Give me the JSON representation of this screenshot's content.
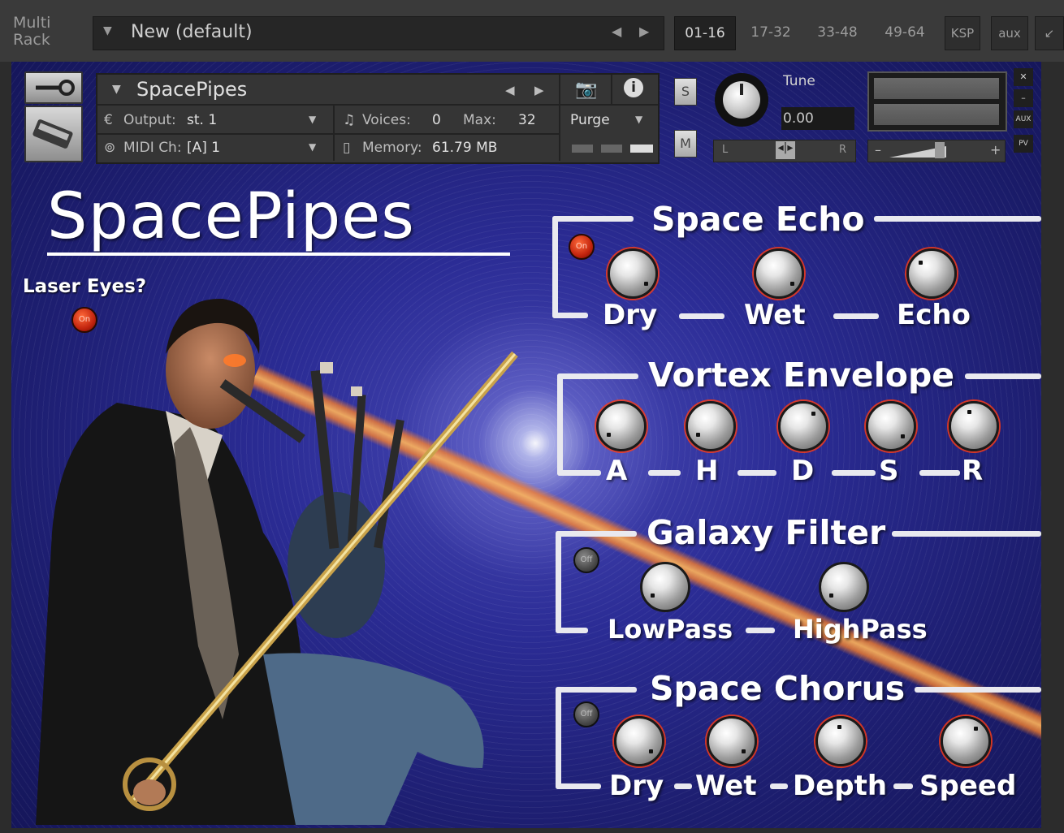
{
  "topbar": {
    "rack_label_line1": "Multi",
    "rack_label_line2": "Rack",
    "preset_name": "New (default)",
    "pages": [
      "01-16",
      "17-32",
      "33-48",
      "49-64"
    ],
    "active_page": "01-16",
    "ksp_label": "KSP",
    "aux_label": "aux"
  },
  "instrument": {
    "name": "SpacePipes",
    "output_label": "Output:",
    "output_value": "st. 1",
    "voices_label": "Voices:",
    "voices_value": "0",
    "max_label": "Max:",
    "max_value": "32",
    "purge_label": "Purge",
    "midi_label": "MIDI Ch:",
    "midi_value": "[A]  1",
    "memory_label": "Memory:",
    "memory_value": "61.79 MB",
    "solo_label": "S",
    "mute_label": "M",
    "tune_label": "Tune",
    "tune_value": "0.00",
    "pan_left": "L",
    "pan_right": "R",
    "vol_minus": "–",
    "vol_plus": "+",
    "side_aux": "AUX",
    "side_pv": "PV"
  },
  "ui": {
    "title": "SpacePipes",
    "laser_label": "Laser Eyes?",
    "laser_state": "On",
    "sections": {
      "space_echo": {
        "title": "Space Echo",
        "state": "On",
        "knobs": [
          "Dry",
          "Wet",
          "Echo"
        ]
      },
      "vortex_envelope": {
        "title": "Vortex Envelope",
        "knobs": [
          "A",
          "H",
          "D",
          "S",
          "R"
        ]
      },
      "galaxy_filter": {
        "title": "Galaxy Filter",
        "state": "Off",
        "knobs": [
          "LowPass",
          "HighPass"
        ]
      },
      "space_chorus": {
        "title": "Space Chorus",
        "state": "Off",
        "knobs": [
          "Dry",
          "Wet",
          "Depth",
          "Speed"
        ]
      }
    }
  },
  "colors": {
    "panel_bg": "#2b2c95",
    "beam": "#ff8030",
    "on_button": "#d0300f"
  }
}
